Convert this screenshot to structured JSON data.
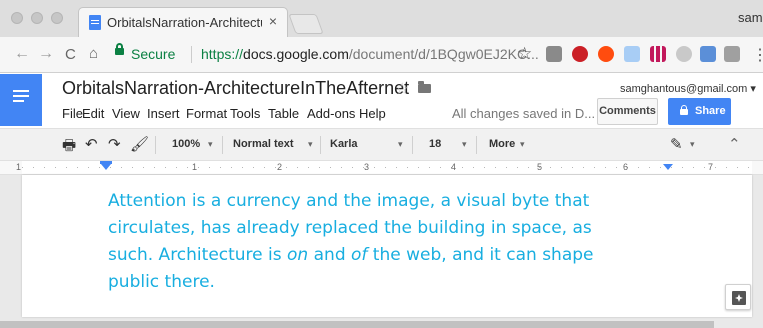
{
  "browser": {
    "tab_title": "OrbitalsNarration-Architecture",
    "tab_close": "×",
    "profile_name": "sam",
    "nav": {
      "back": "←",
      "forward": "→",
      "reload": "C",
      "home": "⌂"
    },
    "secure_label": "Secure",
    "url_prefix": "https://",
    "url_domain": "docs.google.com",
    "url_path": "/document/d/1BQgw0EJ2KC...",
    "bookmark_star": "☆",
    "extension_icons": [
      "translate-extension-icon",
      "pinterest-extension-icon",
      "opera-extension-icon",
      "document-extension-icon",
      "stripes-extension-icon",
      "cloud-extension-icon",
      "picture-extension-icon",
      "camera-extension-icon",
      "more-menu-icon"
    ],
    "more_menu": "⋮"
  },
  "docs": {
    "title": "OrbitalsNarration-ArchitectureInTheAfternet",
    "star": "☆",
    "menu": [
      "File",
      "Edit",
      "View",
      "Insert",
      "Format",
      "Tools",
      "Table",
      "Add-ons",
      "Help"
    ],
    "save_status": "All changes saved in D...",
    "account_email": "samghantous@gmail.com",
    "account_caret": "▾",
    "comments_label": "Comments",
    "share_label": "Share",
    "colors": {
      "brand_blue": "#4285f4",
      "text_cyan": "#18aee0",
      "secure_green": "#0b8043"
    }
  },
  "toolbar": {
    "print_icon": "🖶",
    "undo_icon": "↶",
    "redo_icon": "↷",
    "paint_format_icon": "🖌",
    "zoom": "100%",
    "style": "Normal text",
    "font": "Karla",
    "font_size": "18",
    "more": "More",
    "caret": "▾",
    "pen_icon": "✎",
    "collapse_icon": "⌃"
  },
  "ruler": {
    "numbers": [
      "1",
      "1",
      "2",
      "3",
      "4",
      "5",
      "6",
      "7"
    ]
  },
  "document": {
    "lines": [
      {
        "text": "Attention is a currency and the image, a visual byte that"
      },
      {
        "text": "circulates, has already replaced the building in space, as"
      },
      {
        "pre": "such. Architecture is ",
        "em1": "on",
        "mid": " and ",
        "em2": "of",
        "post": " the web, and it can shape"
      },
      {
        "text": "public there."
      }
    ]
  }
}
